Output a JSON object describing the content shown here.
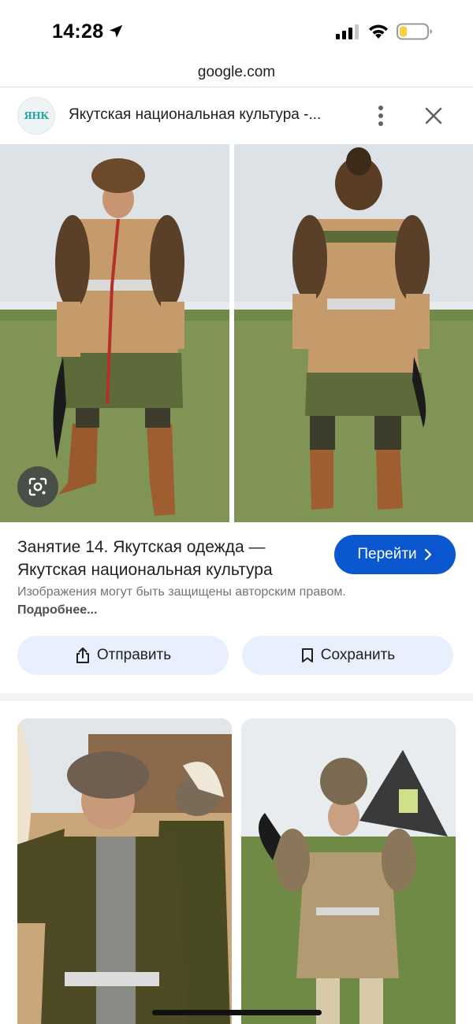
{
  "status_bar": {
    "time": "14:28"
  },
  "browser": {
    "url": "google.com"
  },
  "source": {
    "logo_text": "ЯНК",
    "title": "Якутская национальная культура -..."
  },
  "result": {
    "title": "Занятие 14. Якутская одежда — Якутская национальная культура",
    "visit_label": "Перейти",
    "copyright_text": "Изображения могут быть защищены авторским правом.",
    "more_link": "Подробнее...",
    "share_label": "Отправить",
    "save_label": "Сохранить"
  },
  "icons": {
    "location": "location-arrow-icon",
    "signal": "cellular-signal-icon",
    "wifi": "wifi-icon",
    "battery": "battery-low-icon",
    "more": "more-vertical-icon",
    "close": "close-icon",
    "lens": "google-lens-icon",
    "chevron": "chevron-right-icon",
    "share": "share-icon",
    "bookmark": "bookmark-icon"
  },
  "colors": {
    "accent": "#0b57d0",
    "tonal_button": "#e8f0fe",
    "battery_fill": "#f4d03f",
    "secondary_text": "#70757a"
  }
}
